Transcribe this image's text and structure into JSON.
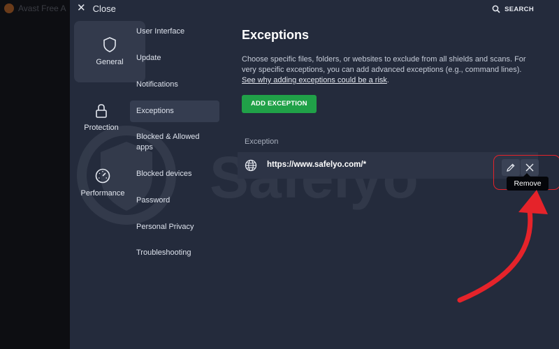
{
  "background_app": {
    "title": "Avast Free A"
  },
  "topbar": {
    "close_label": "Close",
    "search_label": "SEARCH"
  },
  "categories": [
    {
      "label": "General",
      "icon": "shield-icon",
      "selected": true
    },
    {
      "label": "Protection",
      "icon": "lock-icon",
      "selected": false
    },
    {
      "label": "Performance",
      "icon": "speedometer-icon",
      "selected": false
    }
  ],
  "submenu": [
    {
      "label": "User Interface"
    },
    {
      "label": "Update"
    },
    {
      "label": "Notifications"
    },
    {
      "label": "Exceptions",
      "active": true
    },
    {
      "label": "Blocked & Allowed apps"
    },
    {
      "label": "Blocked devices"
    },
    {
      "label": "Password"
    },
    {
      "label": "Personal Privacy"
    },
    {
      "label": "Troubleshooting"
    }
  ],
  "exceptions": {
    "title": "Exceptions",
    "description": "Choose specific files, folders, or websites to exclude from all shields and scans. For very specific exceptions, you can add advanced exceptions (e.g., command lines).",
    "risk_link": "See why adding exceptions could be a risk",
    "risk_link_suffix": ".",
    "add_button": "ADD EXCEPTION",
    "column_header": "Exception",
    "items": [
      {
        "value": "https://www.safelyo.com/*",
        "icon": "globe-icon"
      }
    ],
    "edit_icon": "pencil-icon",
    "remove_icon": "close-icon",
    "tooltip": "Remove"
  },
  "watermark": {
    "text": "Safelyo"
  },
  "colors": {
    "panel": "#242b3c",
    "accent_green": "#20a148",
    "highlight_red": "#e5232a",
    "selected_tile": "#333a4c"
  }
}
